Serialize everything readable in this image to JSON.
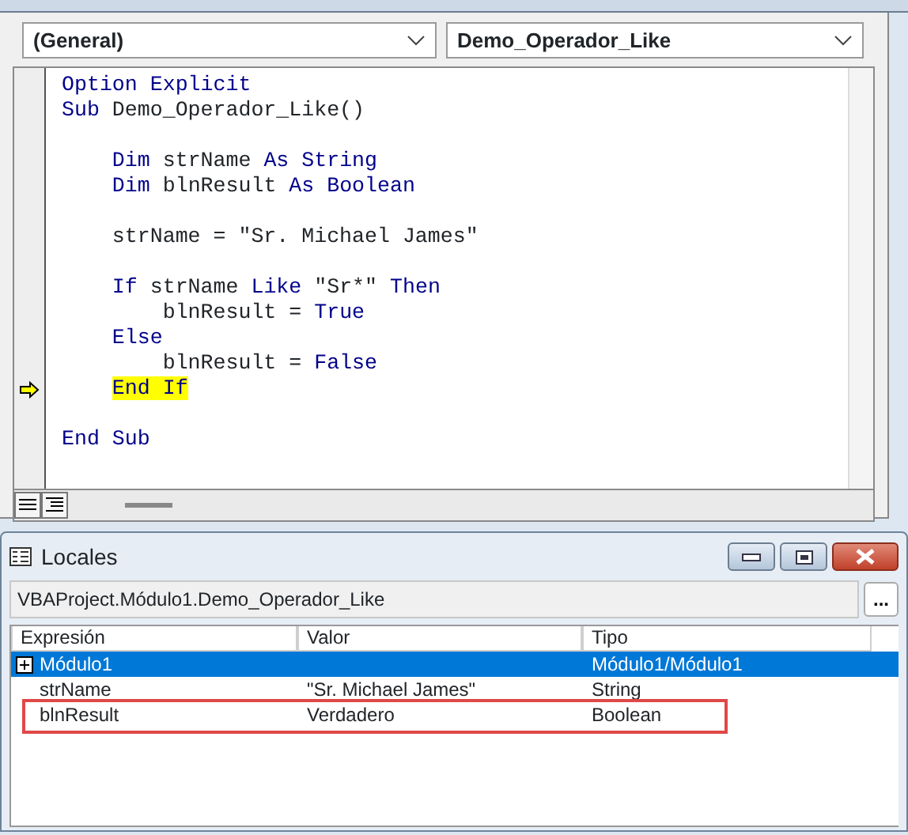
{
  "code_window": {
    "object_combo": "(General)",
    "procedure_combo": "Demo_Operador_Like",
    "blocks": [
      {
        "lines": [
          {
            "segments": [
              {
                "kind": "keyword",
                "text": "Option Explicit"
              }
            ],
            "current": false
          },
          {
            "segments": [
              {
                "kind": "keyword",
                "text": "Sub"
              },
              {
                "kind": "text",
                "text": " Demo_Operador_Like()"
              }
            ],
            "current": false
          }
        ]
      },
      {
        "lines": [
          {
            "segments": [
              {
                "kind": "keyword",
                "text": "    Dim"
              },
              {
                "kind": "text",
                "text": " strName "
              },
              {
                "kind": "keyword",
                "text": "As String"
              }
            ],
            "current": false
          },
          {
            "segments": [
              {
                "kind": "keyword",
                "text": "    Dim"
              },
              {
                "kind": "text",
                "text": " blnResult "
              },
              {
                "kind": "keyword",
                "text": "As Boolean"
              }
            ],
            "current": false
          }
        ]
      },
      {
        "lines": [
          {
            "segments": [
              {
                "kind": "text",
                "text": "    strName = \"Sr. Michael James\""
              }
            ],
            "current": false
          }
        ]
      },
      {
        "lines": [
          {
            "segments": [
              {
                "kind": "keyword",
                "text": "    If"
              },
              {
                "kind": "text",
                "text": " strName "
              },
              {
                "kind": "keyword",
                "text": "Like"
              },
              {
                "kind": "text",
                "text": " \"Sr*\" "
              },
              {
                "kind": "keyword",
                "text": "Then"
              }
            ],
            "current": false
          },
          {
            "segments": [
              {
                "kind": "text",
                "text": "        blnResult = "
              },
              {
                "kind": "keyword",
                "text": "True"
              }
            ],
            "current": false
          },
          {
            "segments": [
              {
                "kind": "keyword",
                "text": "    Else"
              }
            ],
            "current": false
          },
          {
            "segments": [
              {
                "kind": "text",
                "text": "        blnResult = "
              },
              {
                "kind": "keyword",
                "text": "False"
              }
            ],
            "current": false
          },
          {
            "segments": [
              {
                "kind": "keyword",
                "text": "    End If"
              }
            ],
            "current": true
          }
        ]
      },
      {
        "lines": [
          {
            "segments": [
              {
                "kind": "keyword",
                "text": "End Sub"
              }
            ],
            "current": false
          }
        ]
      }
    ]
  },
  "locals": {
    "title": "Locales",
    "context": "VBAProject.Módulo1.Demo_Operador_Like",
    "context_button": "...",
    "columns": [
      "Expresión",
      "Valor",
      "Tipo"
    ],
    "rows": [
      {
        "expression": "Módulo1",
        "type": "Módulo1/Módulo1",
        "expanded": false,
        "selected": true,
        "marked": false
      },
      {
        "expression": "strName",
        "value": "\"Sr. Michael James\"",
        "type": "String",
        "selected": false,
        "marked": false
      },
      {
        "expression": "blnResult",
        "value": "Verdadero",
        "type": "Boolean",
        "selected": false,
        "marked": true
      }
    ]
  }
}
